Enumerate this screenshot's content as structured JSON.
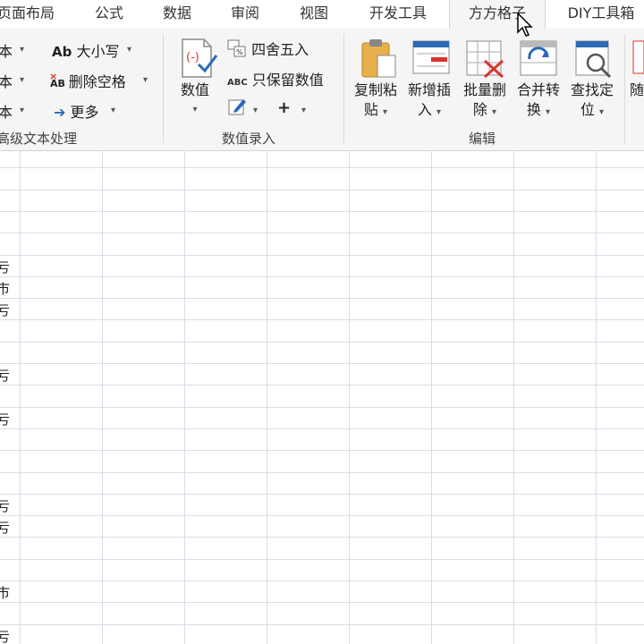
{
  "tabs": [
    {
      "label": "页面布局"
    },
    {
      "label": "公式"
    },
    {
      "label": "数据"
    },
    {
      "label": "审阅"
    },
    {
      "label": "视图"
    },
    {
      "label": "开发工具"
    },
    {
      "label": "方方格子"
    },
    {
      "label": "DIY工具箱"
    }
  ],
  "ribbon": {
    "text_group": {
      "left_items": [
        "本",
        "本",
        "本"
      ],
      "case_label": "大小写",
      "case_icon": "Ab",
      "remove_space_label": "删除空格",
      "remove_space_icon": "AB",
      "more_label": "更多",
      "group_label": "高级文本处理"
    },
    "number_group": {
      "value_label": "数值",
      "round_label": "四舍五入",
      "keep_value_label": "只保留数值",
      "keep_value_icon": "ABC",
      "plus_label": "+",
      "group_label": "数值录入"
    },
    "edit_group": {
      "buttons": [
        {
          "line1": "复制粘",
          "line2": "贴"
        },
        {
          "line1": "新增插",
          "line2": "入"
        },
        {
          "line1": "批量删",
          "line2": "除"
        },
        {
          "line1": "合并转",
          "line2": "换"
        },
        {
          "line1": "查找定",
          "line2": "位"
        }
      ],
      "partial_label": "随",
      "group_label": "编辑"
    }
  },
  "grid": {
    "row_texts": [
      {
        "text": "亏"
      },
      {
        "text": "市"
      },
      {
        "text": "亏"
      },
      {
        "text": "亏"
      },
      {
        "text": "亏"
      },
      {
        "text": "亏"
      },
      {
        "text": "亏"
      },
      {
        "text": "市"
      },
      {
        "text": "亏"
      }
    ]
  },
  "colors": {
    "ribbon_bg": "#f5f5f5",
    "grid_line": "#d8dde6",
    "accent_blue": "#2a6ab8",
    "accent_red": "#d9342b"
  }
}
